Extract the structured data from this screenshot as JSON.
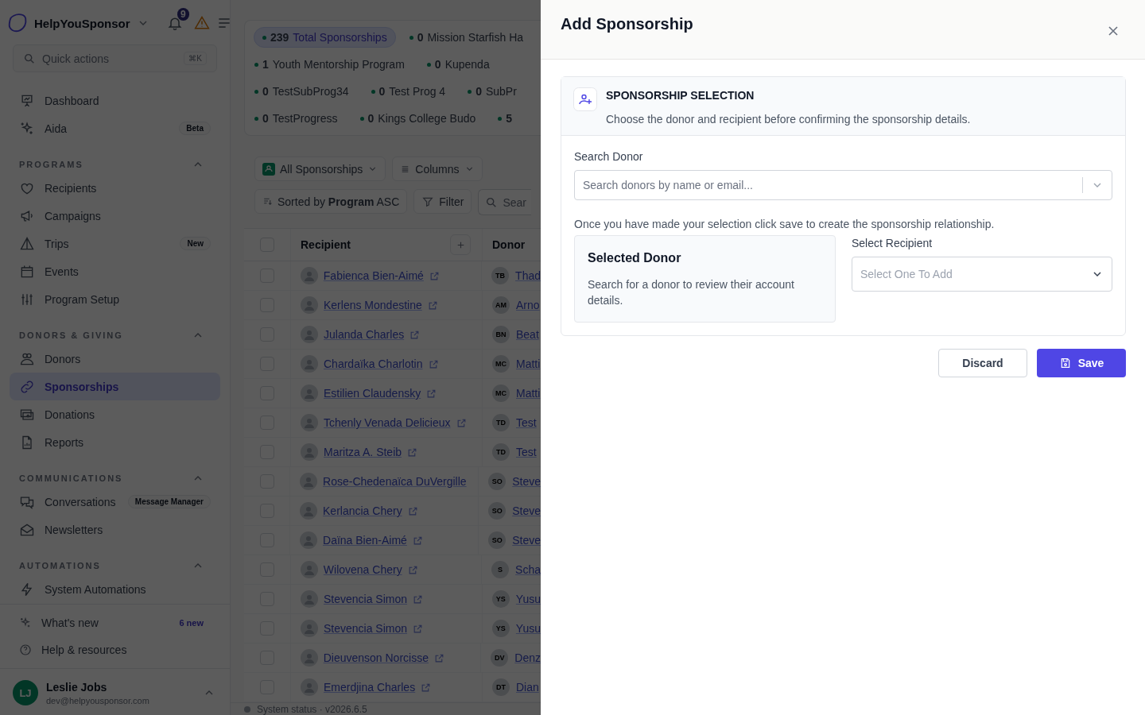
{
  "sidebar": {
    "brand": "HelpYouSponsor",
    "notification_count": "9",
    "quick_actions": {
      "placeholder": "Quick actions",
      "shortcut": "⌘K"
    },
    "top_items": [
      {
        "label": "Dashboard",
        "selected": false
      },
      {
        "label": "Aida",
        "badge": "Beta",
        "selected": false
      }
    ],
    "sections": [
      {
        "title": "PROGRAMS",
        "expanded": true,
        "items": [
          {
            "label": "Recipients",
            "selected": false
          },
          {
            "label": "Campaigns",
            "selected": false
          },
          {
            "label": "Trips",
            "badge": "New",
            "selected": false
          },
          {
            "label": "Events",
            "selected": false
          },
          {
            "label": "Program Setup",
            "selected": false
          }
        ]
      },
      {
        "title": "DONORS & GIVING",
        "expanded": true,
        "items": [
          {
            "label": "Donors",
            "selected": false
          },
          {
            "label": "Sponsorships",
            "selected": true
          },
          {
            "label": "Donations",
            "selected": false
          },
          {
            "label": "Reports",
            "selected": false
          }
        ]
      },
      {
        "title": "COMMUNICATIONS",
        "expanded": true,
        "items": [
          {
            "label": "Conversations",
            "badge": "Message Manager",
            "selected": false
          },
          {
            "label": "Newsletters",
            "selected": false
          }
        ]
      },
      {
        "title": "AUTOMATIONS",
        "expanded": true,
        "items": [
          {
            "label": "System Automations",
            "selected": false
          }
        ]
      }
    ],
    "footer_items": [
      {
        "label": "What's new",
        "badge": "6 new"
      },
      {
        "label": "Help & resources"
      }
    ],
    "user": {
      "initials": "LJ",
      "name": "Leslie Jobs",
      "email": "dev@helpyousponsor.com"
    }
  },
  "main": {
    "stat_rows": [
      [
        {
          "count": "239",
          "label": "Total Sponsorships",
          "selected": true
        },
        {
          "count": "0",
          "label": "Mission Starfish Ha",
          "selected": false
        }
      ],
      [
        {
          "count": "1",
          "label": "Youth Mentorship Program",
          "selected": false
        },
        {
          "count": "0",
          "label": "Kupenda",
          "selected": false
        }
      ],
      [
        {
          "count": "0",
          "label": "TestSubProg34",
          "selected": false
        },
        {
          "count": "0",
          "label": "Test Prog 4",
          "selected": false
        },
        {
          "count": "0",
          "label": "SubPr",
          "selected": false
        }
      ],
      [
        {
          "count": "0",
          "label": "TestProgress",
          "selected": false
        },
        {
          "count": "0",
          "label": "Kings College Budo",
          "selected": false
        },
        {
          "count": "5",
          "selected": false
        }
      ]
    ],
    "view_button": "All Sponsorships",
    "columns_button": "Columns",
    "sort_label": "Sorted by **Program** ASC",
    "filter_button": "Filter",
    "search_placeholder": "Sear",
    "table": {
      "header_checked": false,
      "columns": [
        "Recipient",
        "Donor"
      ],
      "rows": [
        {
          "checked": false,
          "recipient": "Fabienca Bien-Aimé",
          "link_icon": true,
          "donor_initials": "TB",
          "donor": "Thad"
        },
        {
          "checked": false,
          "recipient": "Kerlens Mondestine",
          "link_icon": true,
          "donor_initials": "AM",
          "donor": "Arno"
        },
        {
          "checked": false,
          "recipient": "Julanda Charles",
          "link_icon": true,
          "donor_initials": "BN",
          "donor": "Beat"
        },
        {
          "checked": false,
          "recipient": "Chardaïka Charlotin",
          "link_icon": true,
          "donor_initials": "MC",
          "donor": "Matti"
        },
        {
          "checked": false,
          "recipient": "Estilien Claudensky",
          "link_icon": true,
          "donor_initials": "MC",
          "donor": "Matti"
        },
        {
          "checked": false,
          "recipient": "Tchenly Venada Delicieux",
          "link_icon": true,
          "donor_initials": "TD",
          "donor": "Test"
        },
        {
          "checked": false,
          "recipient": "Maritza A. Steib",
          "link_icon": true,
          "donor_initials": "TD",
          "donor": "Test"
        },
        {
          "checked": false,
          "recipient": "Rose-Chedenaïca DuVergille",
          "link_icon": false,
          "donor_initials": "SO",
          "donor": "Steve"
        },
        {
          "checked": false,
          "recipient": "Kerlancia Chery",
          "link_icon": true,
          "donor_initials": "SO",
          "donor": "Steve"
        },
        {
          "checked": false,
          "recipient": "Daïna Bien-Aimé",
          "link_icon": true,
          "donor_initials": "SO",
          "donor": "Steve"
        },
        {
          "checked": false,
          "recipient": "Wilovena Chery",
          "link_icon": true,
          "donor_initials": "S",
          "donor": "Scha"
        },
        {
          "checked": false,
          "recipient": "Stevencia Simon",
          "link_icon": true,
          "donor_initials": "YS",
          "donor": "Yusu"
        },
        {
          "checked": false,
          "recipient": "Stevencia Simon",
          "link_icon": true,
          "donor_initials": "YS",
          "donor": "Yusu"
        },
        {
          "checked": false,
          "recipient": "Dieuvenson Norcisse",
          "link_icon": true,
          "donor_initials": "DV",
          "donor": "Denz"
        },
        {
          "checked": false,
          "recipient": "Emerdjina Charles",
          "link_icon": true,
          "donor_initials": "DT",
          "donor": "Dian"
        }
      ]
    },
    "status": "System status · v2026.6.5"
  },
  "drawer": {
    "title": "Add Sponsorship",
    "section_title": "SPONSORSHIP SELECTION",
    "section_description": "Choose the donor and recipient before confirming the sponsorship details.",
    "search_label": "Search Donor",
    "search_placeholder": "Search donors by name or email...",
    "note": "Once you have made your selection click save to create the sponsorship relationship.",
    "selected_donor_title": "Selected Donor",
    "selected_donor_text": "Search for a donor to review their account details.",
    "recipient_label": "Select Recipient",
    "recipient_placeholder": "Select One To Add",
    "discard_button": "Discard",
    "save_button": "Save"
  }
}
